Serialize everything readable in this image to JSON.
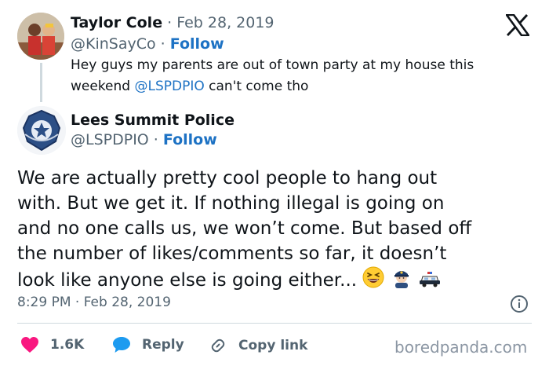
{
  "reply_to": {
    "name": "Taylor Cole",
    "date": "Feb 28, 2019",
    "handle": "@KinSayCo",
    "follow": "Follow",
    "text_line1": "Hey guys my parents are out of town party at my house this",
    "text_line2_prefix": "weekend ",
    "mention": "@LSPDPIO",
    "text_line2_suffix": " can't come tho"
  },
  "tweet": {
    "name": "Lees Summit Police",
    "handle": "@LSPDPIO",
    "follow": "Follow",
    "lines": [
      "We are actually pretty cool people to hang out",
      "with.  But we get it.  If nothing illegal is going on",
      "and no one calls us, we won’t come.  But based off",
      "the number of likes/comments so far, it doesn’t",
      "look like anyone else is going either..."
    ],
    "emojis": [
      "grinning-squinting-face-icon",
      "police-officer-icon",
      "police-car-icon"
    ],
    "timestamp": "8:29 PM · Feb 28, 2019"
  },
  "actions": {
    "likes": "1.6K",
    "reply": "Reply",
    "copy_link": "Copy link"
  },
  "watermark": "boredpanda.com",
  "colors": {
    "link": "#1d72c4",
    "heart": "#f91880",
    "secondary": "#536471"
  }
}
